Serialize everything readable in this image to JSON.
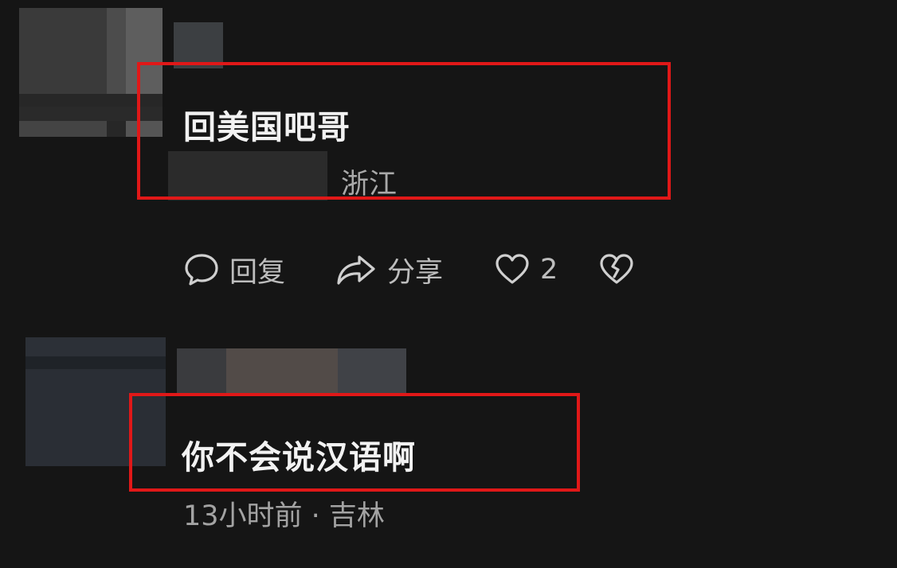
{
  "comments": [
    {
      "text": "回美国吧哥",
      "location": "浙江",
      "actions": {
        "reply_label": "回复",
        "share_label": "分享",
        "like_count": "2"
      }
    },
    {
      "text": "你不会说汉语啊",
      "meta": "13小时前 · 吉林"
    }
  ],
  "icons": {
    "reply": "speech-bubble-icon",
    "share": "share-arrow-icon",
    "like": "heart-outline-icon",
    "dislike": "broken-heart-icon"
  },
  "colors": {
    "background": "#151515",
    "highlight": "#e01818",
    "primary_text": "#f2f2f2",
    "secondary_text": "#a9a9a9"
  }
}
